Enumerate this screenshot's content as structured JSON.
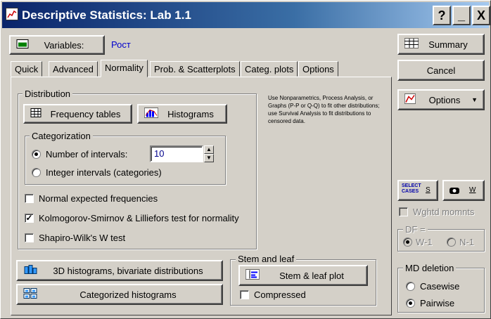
{
  "window": {
    "title": "Descriptive Statistics: Lab 1.1"
  },
  "titlebar_buttons": {
    "help": "?",
    "minimize": "_",
    "close": "X"
  },
  "variables": {
    "button_label": "Variables:",
    "value": "Рост"
  },
  "tabs": [
    {
      "label": "Quick"
    },
    {
      "label": "Advanced"
    },
    {
      "label": "Normality"
    },
    {
      "label": "Prob. & Scatterplots"
    },
    {
      "label": "Categ. plots"
    },
    {
      "label": "Options"
    }
  ],
  "active_tab": "Normality",
  "distribution": {
    "title": "Distribution",
    "frequency_tables": "Frequency tables",
    "histograms": "Histograms"
  },
  "categorization": {
    "title": "Categorization",
    "number_of_intervals": "Number of intervals:",
    "intervals_value": "10",
    "integer_intervals": "Integer intervals (categories)"
  },
  "checks": {
    "normal_expected": "Normal expected frequencies",
    "ks_lilliefors": "Kolmogorov-Smirnov & Lilliefors test for normality",
    "shapiro_wilk": "Shapiro-Wilk's W test"
  },
  "note": "Use Nonparametrics, Process Analysis, or Graphs (P-P or Q-Q) to fit other distributions; use Survival Analysis to fit distributions to censored data.",
  "bottom_buttons": {
    "hist3d": "3D histograms, bivariate distributions",
    "categorized_histograms": "Categorized histograms"
  },
  "stem_leaf": {
    "title": "Stem and leaf",
    "plot": "Stem & leaf plot",
    "compressed": "Compressed"
  },
  "right_panel": {
    "summary": "Summary",
    "cancel": "Cancel",
    "options": "Options",
    "select_cases_top": "SELECT",
    "select_cases_bottom": "CASES",
    "select_s": "S",
    "weight_w": "W",
    "wghtd_momnts": "Wghtd momnts",
    "df_title": "DF =",
    "df_w1": "W-1",
    "df_n1": "N-1",
    "md_title": "MD deletion",
    "casewise": "Casewise",
    "pairwise": "Pairwise"
  }
}
